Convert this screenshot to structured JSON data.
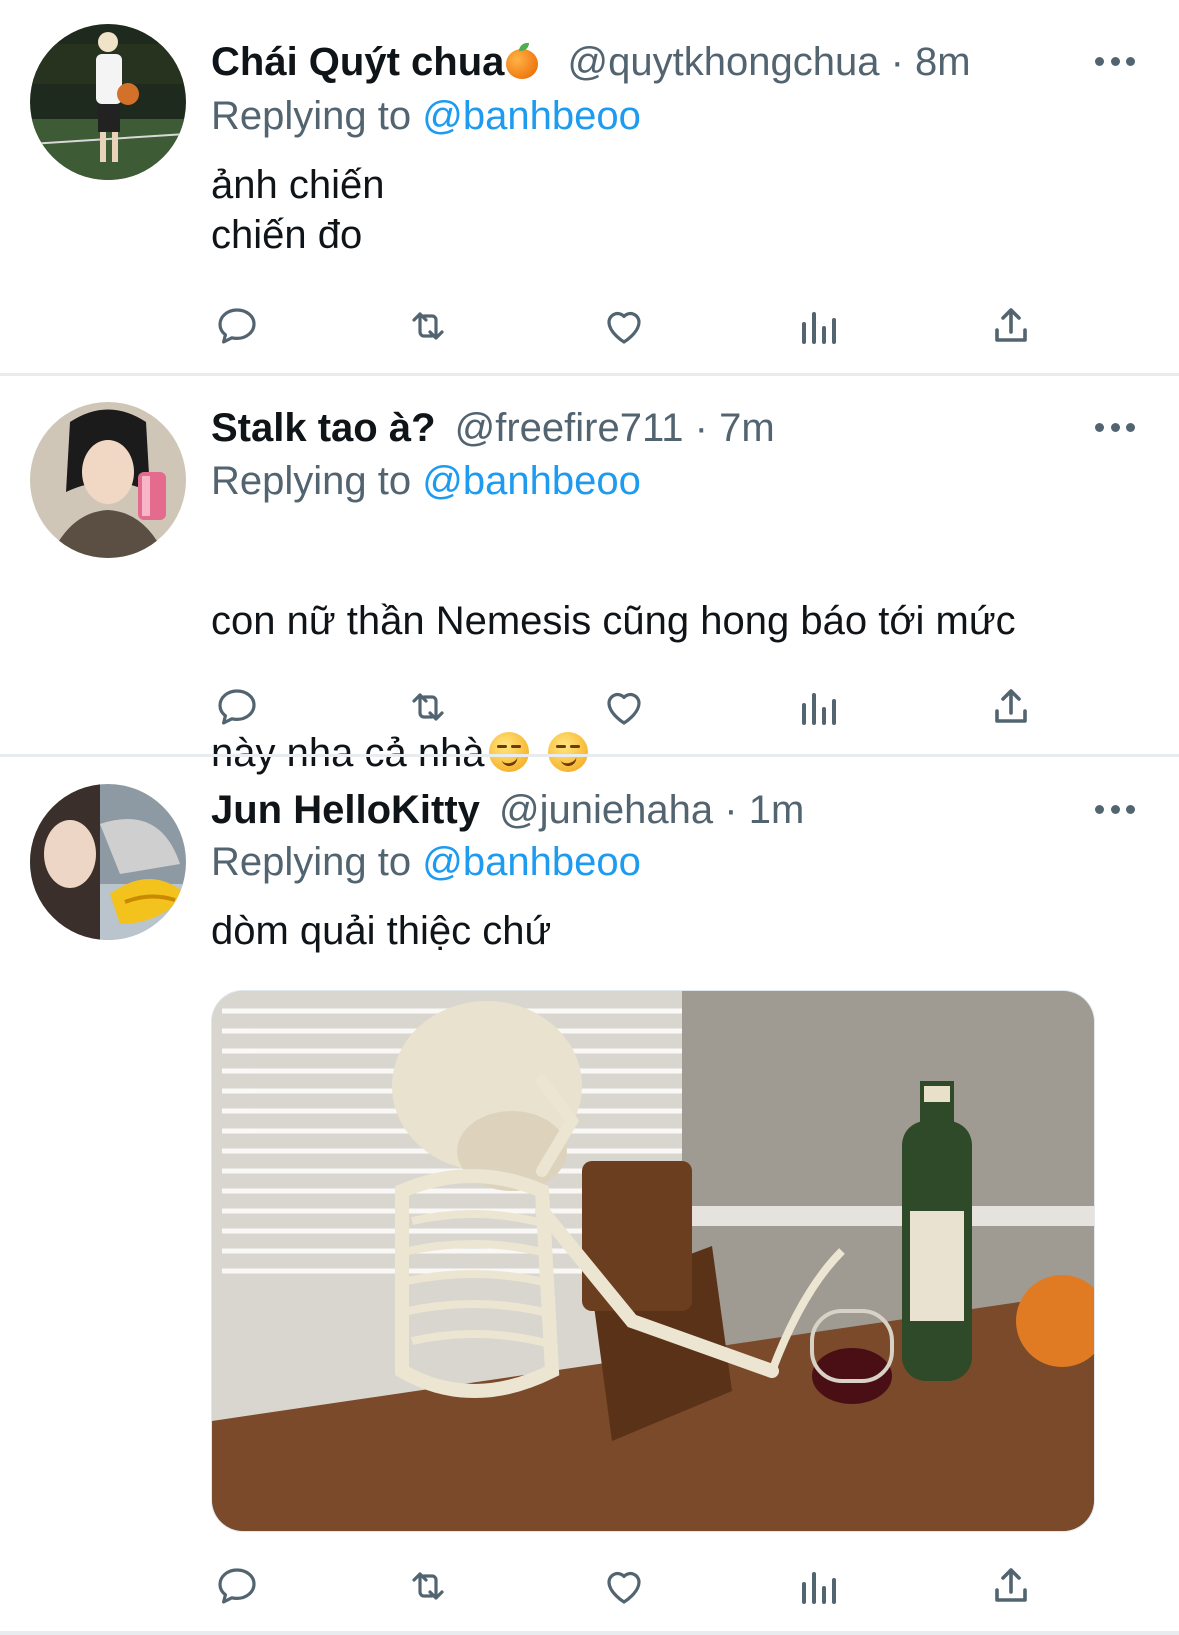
{
  "tweets": [
    {
      "display_name": "Chái Quýt chua",
      "name_icon": "orange-fruit-emoji",
      "handle": "@quytkhongchua",
      "time": "· 8m",
      "replying_prefix": "Replying to ",
      "replying_to": "@banhbeoo",
      "text": "ảnh chiến\nchiến đo",
      "avatar_desc": "person-holding-basketball-photo"
    },
    {
      "display_name": "Stalk tao à?",
      "handle": "@freefire711",
      "time": "· 7m",
      "replying_prefix": "Replying to ",
      "replying_to": "@banhbeoo",
      "text_line1": "con nữ thần Nemesis cũng hong báo tới mức",
      "text_line2": "này nha cả nhà",
      "emoji": "smirking-face-emoji",
      "avatar_desc": "person-mirror-selfie-photo"
    },
    {
      "display_name": "Jun HelloKitty",
      "handle": "@juniehaha",
      "time": "· 1m",
      "replying_prefix": "Replying to ",
      "replying_to": "@banhbeoo",
      "text": "dòm quải thiệc chứ",
      "avatar_desc": "person-with-duck-mask-photo",
      "media": "skeleton-sitting-at-table-with-wine-photo"
    }
  ],
  "actions": [
    "reply-icon",
    "retweet-icon",
    "like-icon",
    "analytics-icon",
    "share-icon"
  ],
  "colors": {
    "text": "#0f1419",
    "muted": "#536471",
    "link": "#1d9bf0",
    "divider": "#e9ecef"
  }
}
